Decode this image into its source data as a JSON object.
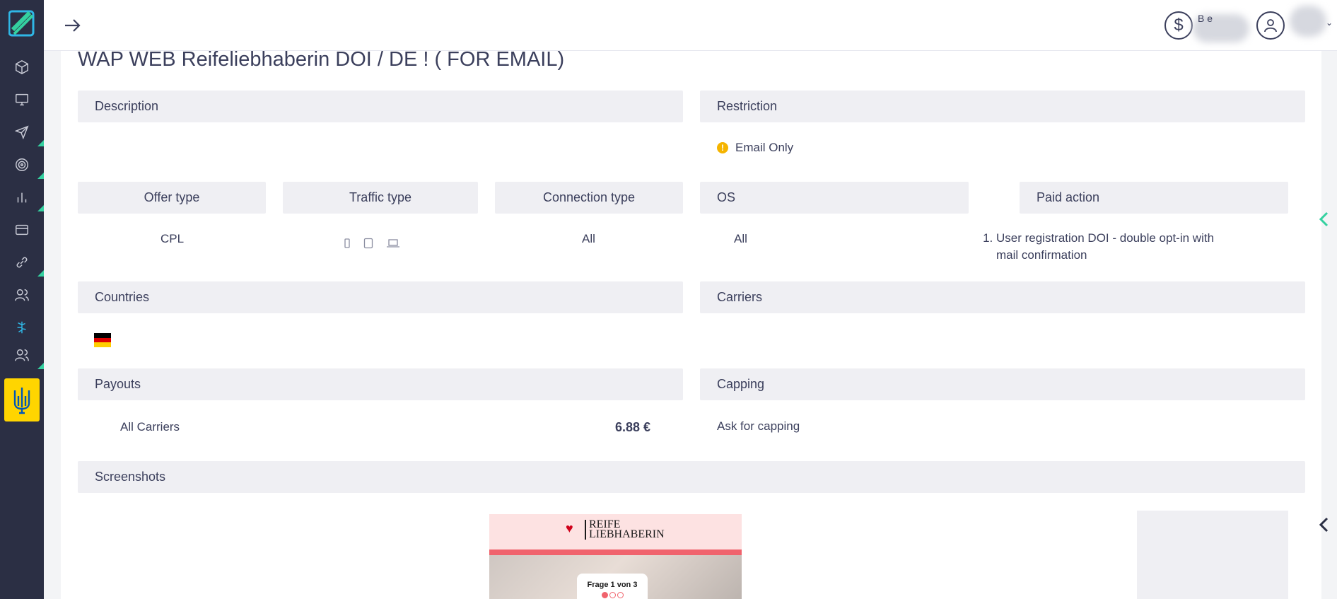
{
  "header": {
    "balance_label": "B     e"
  },
  "offer": {
    "title": "WAP WEB Reifeliebhaberin DOI / DE ! ( FOR EMAIL)"
  },
  "sections": {
    "description": "Description",
    "restriction": "Restriction",
    "offer_type": "Offer type",
    "traffic_type": "Traffic type",
    "connection_type": "Connection type",
    "os": "OS",
    "paid_action": "Paid action",
    "countries": "Countries",
    "carriers": "Carriers",
    "payouts": "Payouts",
    "capping": "Capping",
    "screenshots": "Screenshots"
  },
  "values": {
    "restriction": "Email Only",
    "offer_type": "CPL",
    "connection_type": "All",
    "os": "All",
    "paid_action_items": [
      "User registration DOI - double opt-in with mail confirmation"
    ],
    "payout_carrier": "All Carriers",
    "payout_amount": "6.88 €",
    "capping": "Ask for capping"
  },
  "preview": {
    "logo_line1": "REIFE",
    "logo_line2": "LIEBHABERIN",
    "question": "Frage 1 von 3"
  },
  "colors": {
    "sidebar": "#2b2f44",
    "accent": "#34d1a0",
    "active_icon": "#2fb7e6",
    "warning": "#f5b400",
    "header_bg": "#efeff3"
  }
}
